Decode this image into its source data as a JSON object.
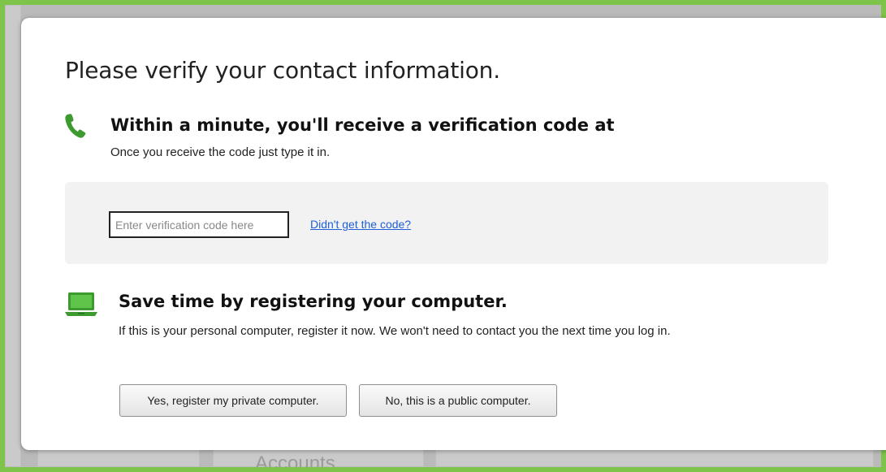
{
  "background": {
    "accounts_label": "Accounts"
  },
  "dialog": {
    "title": "Please verify your contact information.",
    "verification": {
      "icon": "phone-icon",
      "heading": "Within a minute, you'll receive a verification code at",
      "subtext": "Once you receive the code just type it in.",
      "code_input_value": "",
      "code_input_placeholder": "Enter verification code here",
      "resend_link": "Didn't get the code?"
    },
    "register": {
      "icon": "laptop-icon",
      "heading": "Save time by registering your computer.",
      "subtext": "If this is your personal computer, register it now. We won't need to contact you the next time you log in.",
      "yes_button": "Yes, register my private computer.",
      "no_button": "No, this is a public computer."
    }
  },
  "colors": {
    "frame": "#7ec34a",
    "icon_green": "#3d9a2e",
    "link": "#1f5fd6"
  }
}
